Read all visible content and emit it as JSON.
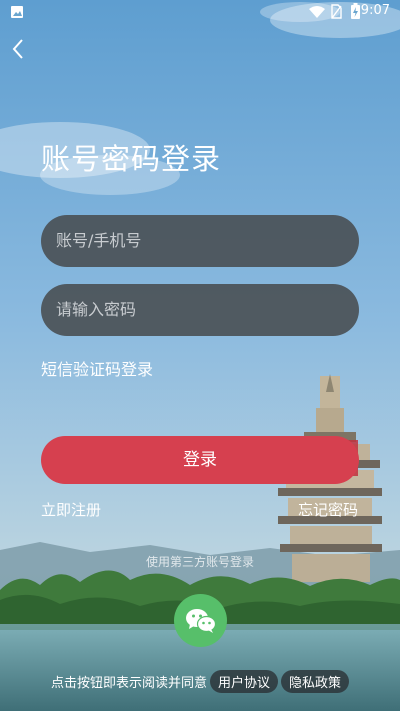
{
  "status_bar": {
    "time": "9:07"
  },
  "page": {
    "title": "账号密码登录"
  },
  "form": {
    "account_placeholder": "账号/手机号",
    "password_placeholder": "请输入密码",
    "sms_login_link": "短信验证码登录",
    "login_button": "登录",
    "register_link": "立即注册",
    "forgot_password_link": "忘记密码"
  },
  "third_party": {
    "label": "使用第三方账号登录",
    "icon": "wechat-icon"
  },
  "agreement": {
    "text": "点击按钮即表示阅读并同意",
    "user_agreement": "用户协议",
    "privacy_policy": "隐私政策"
  },
  "colors": {
    "accent": "#d6404f",
    "wechat": "#57bf6a"
  }
}
